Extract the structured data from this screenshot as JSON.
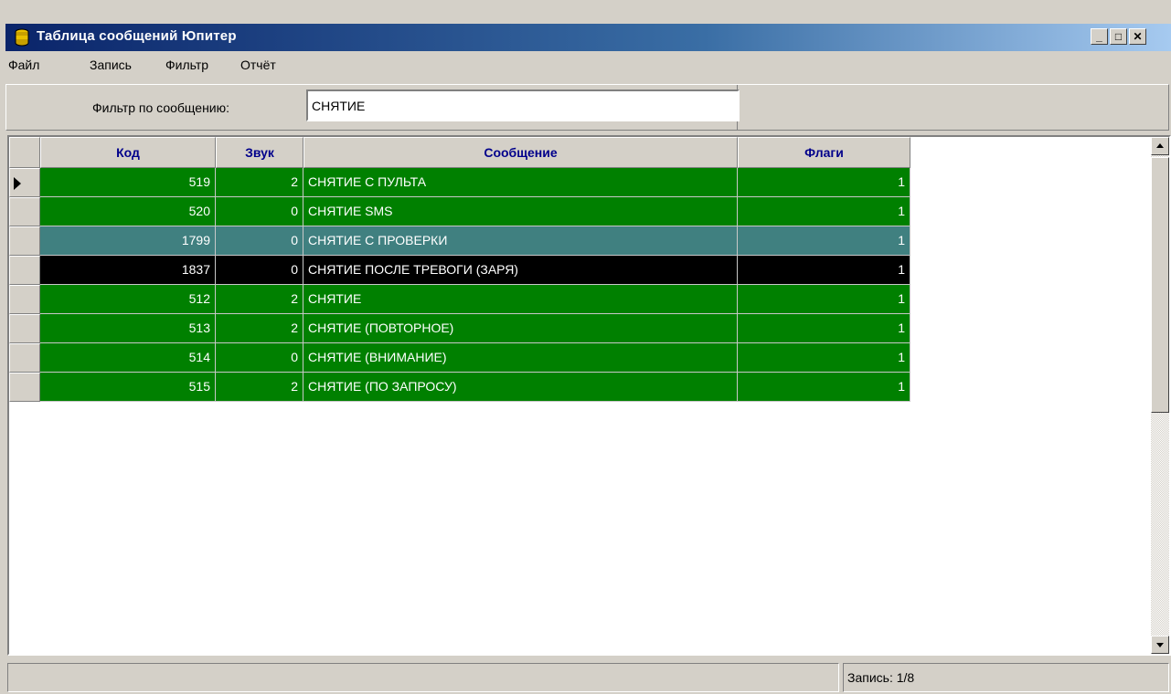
{
  "window": {
    "title": "Таблица сообщений Юпитер",
    "controls": {
      "minimize": "_",
      "maximize": "□",
      "close": "✕"
    }
  },
  "menu": [
    {
      "label": "Файл"
    },
    {
      "label": "Запись"
    },
    {
      "label": "Фильтр"
    },
    {
      "label": "Отчёт"
    }
  ],
  "filter": {
    "label": "Фильтр по сообщению:",
    "value": "СНЯТИЕ"
  },
  "table": {
    "columns": [
      "Код",
      "Звук",
      "Сообщение",
      "Флаги"
    ],
    "current_row_index": 0,
    "rows": [
      {
        "code": "519",
        "sound": "2",
        "message": "СНЯТИЕ С ПУЛЬТА",
        "flags": "1",
        "bg": "#008000"
      },
      {
        "code": "520",
        "sound": "0",
        "message": "СНЯТИЕ SMS",
        "flags": "1",
        "bg": "#008000"
      },
      {
        "code": "1799",
        "sound": "0",
        "message": "СНЯТИЕ С ПРОВЕРКИ",
        "flags": "1",
        "bg": "#408080"
      },
      {
        "code": "1837",
        "sound": "0",
        "message": "СНЯТИЕ ПОСЛЕ ТРЕВОГИ (ЗАРЯ)",
        "flags": "1",
        "bg": "#000000"
      },
      {
        "code": "512",
        "sound": "2",
        "message": "СНЯТИЕ",
        "flags": "1",
        "bg": "#008000"
      },
      {
        "code": "513",
        "sound": "2",
        "message": "СНЯТИЕ (ПОВТОРНОЕ)",
        "flags": "1",
        "bg": "#008000"
      },
      {
        "code": "514",
        "sound": "0",
        "message": "СНЯТИЕ (ВНИМАНИЕ)",
        "flags": "1",
        "bg": "#008000"
      },
      {
        "code": "515",
        "sound": "2",
        "message": "СНЯТИЕ (ПО ЗАПРОСУ)",
        "flags": "1",
        "bg": "#008000"
      }
    ]
  },
  "status": {
    "left": "",
    "record": "Запись: 1/8"
  },
  "colors": {
    "header_text": "#00008b",
    "row_text": "#ffffff",
    "title_gradient_start": "#0a246a"
  },
  "icons": {
    "app": "database-icon",
    "current_row": "row-pointer-icon",
    "scroll_up": "arrow-up-icon",
    "scroll_down": "arrow-down-icon"
  }
}
